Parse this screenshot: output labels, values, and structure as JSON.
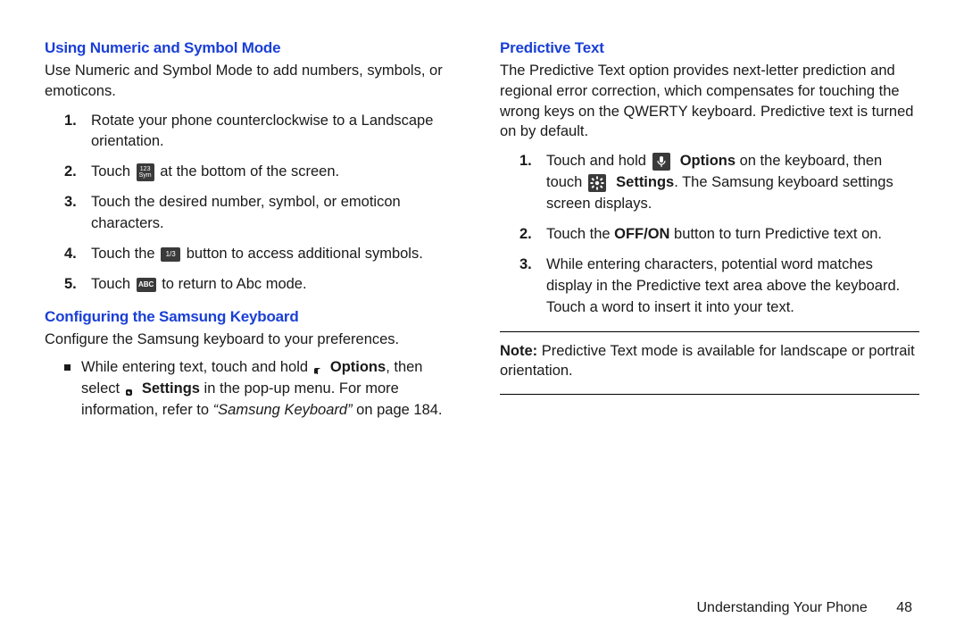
{
  "left": {
    "h1": "Using Numeric and Symbol Mode",
    "intro": "Use Numeric and Symbol Mode to add numbers, symbols, or emoticons.",
    "items": [
      {
        "n": "1.",
        "before": "Rotate your phone counterclockwise to a Landscape orientation."
      },
      {
        "n": "2.",
        "before": "Touch ",
        "icon": "123-sym",
        "after": " at the bottom of the screen."
      },
      {
        "n": "3.",
        "before": "Touch the desired number, symbol, or emoticon characters."
      },
      {
        "n": "4.",
        "before": "Touch the ",
        "icon": "1-3",
        "after": " button to access additional symbols."
      },
      {
        "n": "5.",
        "before": "Touch ",
        "icon": "abc",
        "after": " to return to Abc mode."
      }
    ],
    "h2": "Configuring the Samsung Keyboard",
    "intro2": "Configure the Samsung keyboard to your preferences.",
    "bullet_before": "While entering text, touch and hold ",
    "options_label": "Options",
    "bullet_mid": ", then select ",
    "settings_label": "Settings",
    "bullet_after": " in the pop-up menu. ",
    "bullet_more": "For more information, refer to ",
    "bullet_ref": "“Samsung Keyboard”",
    "bullet_tail_a": " on page ",
    "bullet_page_ref": "184",
    "bullet_tail_b": "."
  },
  "right": {
    "h1": "Predictive Text",
    "intro": "The Predictive Text option provides next-letter prediction and regional error correction, which compensates for touching the wrong keys on the QWERTY keyboard. Predictive text is turned on by default.",
    "item1_before": "Touch and hold ",
    "options_label": "Options",
    "item1_mid": " on the keyboard, then touch ",
    "settings_label": "Settings",
    "item1_after": ". The Samsung keyboard settings screen displays.",
    "item2_before": "Touch the ",
    "item2_bold": "OFF/ON",
    "item2_after": " button to turn Predictive text on.",
    "item3": "While entering characters, potential word matches display in the Predictive text area above the keyboard. Touch a word to insert it into your text.",
    "note_label": "Note:",
    "note_body": " Predictive Text mode is available for landscape or portrait orientation."
  },
  "footer": {
    "section": "Understanding Your Phone",
    "page": "48"
  },
  "icons": {
    "123-sym-top": "123",
    "123-sym-bottom": "Sym",
    "1-3": "1/3",
    "abc": "ABC"
  }
}
